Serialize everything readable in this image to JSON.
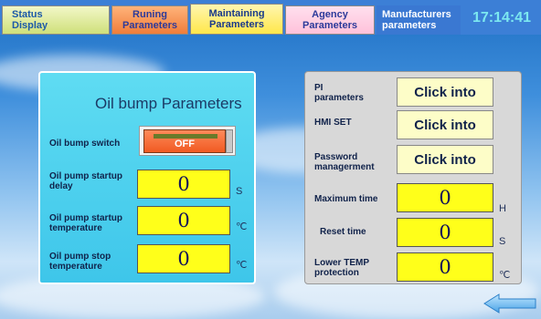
{
  "tabs": [
    {
      "label": "Status Display"
    },
    {
      "label": "Runing Parameters"
    },
    {
      "label": "Maintaining Parameters"
    },
    {
      "label": "Agency Parameters"
    },
    {
      "label": "Manufacturers parameters"
    }
  ],
  "clock": "17:14:41",
  "oil_panel": {
    "title": "Oil bump Parameters",
    "switch_label": "Oil bump switch",
    "switch_state": "OFF",
    "rows": [
      {
        "label": "Oil pump startup delay",
        "value": "0",
        "unit": "S"
      },
      {
        "label": "Oil pump startup temperature",
        "value": "0",
        "unit": "℃"
      },
      {
        "label": "Oil pump stop temperature",
        "value": "0",
        "unit": "℃"
      }
    ]
  },
  "settings_panel": {
    "links": [
      {
        "label": "PI parameters",
        "button": "Click into"
      },
      {
        "label": "HMI SET",
        "button": "Click into"
      },
      {
        "label": "Password managerment",
        "button": "Click into"
      }
    ],
    "rows": [
      {
        "label": "Maximum time",
        "value": "0",
        "unit": "H"
      },
      {
        "label": "Reset time",
        "value": "0",
        "unit": "S"
      },
      {
        "label": "Lower TEMP protection",
        "value": "0",
        "unit": "℃"
      }
    ]
  },
  "icons": {
    "back": "back-arrow-icon"
  },
  "colors": {
    "value_box": "#ffff1a",
    "switch_off": "#f05a22",
    "clock": "#7ce8f0"
  }
}
